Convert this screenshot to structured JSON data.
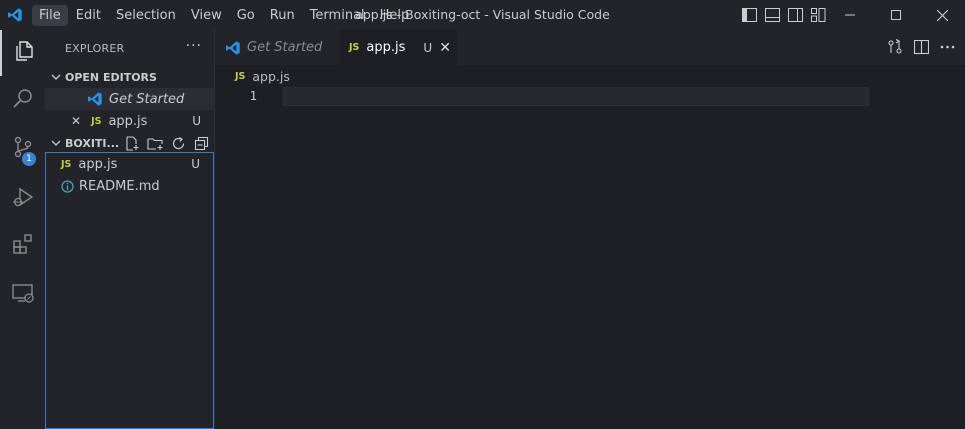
{
  "titlebar": {
    "title": "app.js - Boxiting-oct - Visual Studio Code",
    "menu": [
      "File",
      "Edit",
      "Selection",
      "View",
      "Go",
      "Run",
      "Terminal",
      "Help"
    ],
    "active_menu": "File"
  },
  "activity": {
    "scm_badge": "1"
  },
  "sidebar": {
    "title": "EXPLORER",
    "more": "···",
    "open_editors": {
      "header": "OPEN EDITORS",
      "items": [
        {
          "label": "Get Started",
          "italic": true
        },
        {
          "label": "app.js",
          "badge": "JS",
          "status": "U",
          "close": "✕"
        }
      ]
    },
    "workspace": {
      "header": "BOXITI...",
      "files": [
        {
          "label": "app.js",
          "badge": "JS",
          "status": "U"
        },
        {
          "label": "README.md",
          "icon": "info-icon"
        }
      ]
    }
  },
  "tabs": [
    {
      "label": "Get Started",
      "active": false
    },
    {
      "label": "app.js",
      "badge": "JS",
      "status": "U",
      "close": "✕",
      "active": true
    }
  ],
  "breadcrumb": {
    "badge": "JS",
    "file": "app.js"
  },
  "editor": {
    "line_number": "1"
  },
  "colors": {
    "accent": "#3b78c2",
    "js_yellow": "#cbcb41",
    "vscode_blue": "#2a92e4",
    "badge_blue": "#3b82d6"
  }
}
